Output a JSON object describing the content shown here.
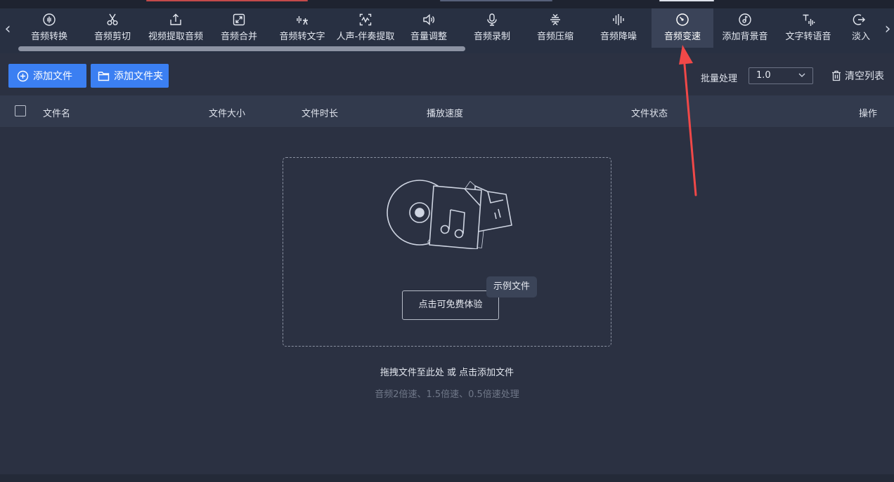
{
  "toolbar": {
    "prev_arrow": "‹",
    "next_arrow": "›",
    "tools": [
      {
        "label": "音频转换",
        "icon": "waveform-circle-icon"
      },
      {
        "label": "音频剪切",
        "icon": "scissors-icon"
      },
      {
        "label": "视频提取音频",
        "icon": "upload-box-icon"
      },
      {
        "label": "音频合并",
        "icon": "merge-arrows-icon"
      },
      {
        "label": "音频转文字",
        "icon": "speech-to-text-icon"
      },
      {
        "label": "人声-伴奏提取",
        "icon": "vocal-separate-icon"
      },
      {
        "label": "音量调整",
        "icon": "speaker-icon"
      },
      {
        "label": "音频录制",
        "icon": "microphone-icon"
      },
      {
        "label": "音频压缩",
        "icon": "compress-icon"
      },
      {
        "label": "音频降噪",
        "icon": "equalizer-icon"
      },
      {
        "label": "音频变速",
        "icon": "speedometer-icon",
        "active": true
      },
      {
        "label": "添加背景音",
        "icon": "music-disc-icon"
      },
      {
        "label": "文字转语音",
        "icon": "text-to-speech-icon"
      },
      {
        "label": "淡入",
        "icon": "fade-icon"
      }
    ]
  },
  "actions": {
    "add_file": "添加文件",
    "add_folder": "添加文件夹",
    "batch_label": "批量处理",
    "batch_value": "1.0",
    "clear_list": "清空列表"
  },
  "table": {
    "columns": [
      "文件名",
      "文件大小",
      "文件时长",
      "播放速度",
      "文件状态",
      "操作"
    ]
  },
  "drop": {
    "try_button": "点击可免费体验",
    "tooltip": "示例文件",
    "hint_main": "拖拽文件至此处 或 点击添加文件",
    "hint_sub": "音频2倍速、1.5倍速、0.5倍速处理"
  },
  "colors": {
    "accent": "#3b7ff2",
    "annotation_arrow": "#f04848",
    "background": "#2b3142"
  }
}
